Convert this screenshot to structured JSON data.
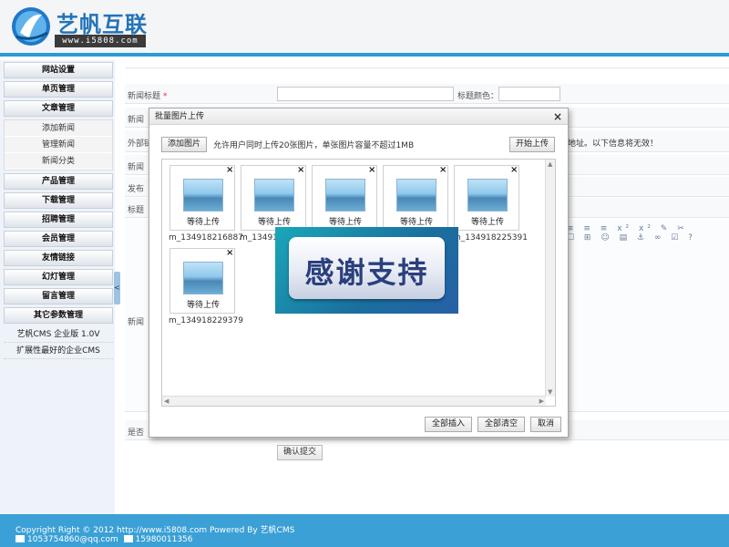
{
  "header": {
    "logo_text": "艺帆互联",
    "logo_url": "www.i5808.com"
  },
  "sidebar": {
    "menu": [
      {
        "label": "网站设置"
      },
      {
        "label": "单页管理"
      },
      {
        "label": "文章管理"
      }
    ],
    "submenu": [
      {
        "label": "添加新闻"
      },
      {
        "label": "管理新闻"
      },
      {
        "label": "新闻分类"
      }
    ],
    "menu2": [
      {
        "label": "产品管理"
      },
      {
        "label": "下载管理"
      },
      {
        "label": "招聘管理"
      },
      {
        "label": "会员管理"
      },
      {
        "label": "友情链接"
      },
      {
        "label": "幻灯管理"
      },
      {
        "label": "留言管理"
      },
      {
        "label": "其它参数管理"
      }
    ],
    "info": [
      "艺帆CMS 企业版 1.0V",
      "扩展性最好的企业CMS"
    ],
    "collapse_glyph": "<"
  },
  "form": {
    "title_label": "新闻标题",
    "required_mark": "*",
    "color_label": "标题颜色：",
    "row2_label": "新闻",
    "row3_label": "外部链",
    "row3_tail": "地址。以下信息将无效！",
    "row4_label": "新闻",
    "row5_label": "发布",
    "row6_label": "标题",
    "row7_label": "新闻",
    "row8_label": "是否",
    "submit_label": "确认提交"
  },
  "editor_icons": "≡ ≡ ≡ x² x² ✎ ✂ ☐ ⊞ ☺ ▤ ⚓ ∞ ☑ ?",
  "dialog": {
    "title": "批量图片上传",
    "close_glyph": "×",
    "add_button": "添加图片",
    "hint": "允许用户同时上传20张图片，单张图片容量不超过1MB",
    "start_button": "开始上传",
    "items": [
      {
        "status": "等待上传",
        "file": "m_134918216887"
      },
      {
        "status": "等待上传",
        "file": "m_134918"
      },
      {
        "status": "等待上传",
        "file": ""
      },
      {
        "status": "等待上传",
        "file": ""
      },
      {
        "status": "等待上传",
        "file": "m_134918225391"
      },
      {
        "status": "等待上传",
        "file": "m_134918229379"
      }
    ],
    "insert_all": "全部插入",
    "clear_all": "全部清空",
    "cancel": "取消"
  },
  "banner": {
    "text": "感谢支持"
  },
  "footer": {
    "copyright": "Copyright Right © 2012 http://www.i5808.com Powered By 艺帆CMS",
    "email": "1053754860@qq.com",
    "phone": "15980011356"
  }
}
